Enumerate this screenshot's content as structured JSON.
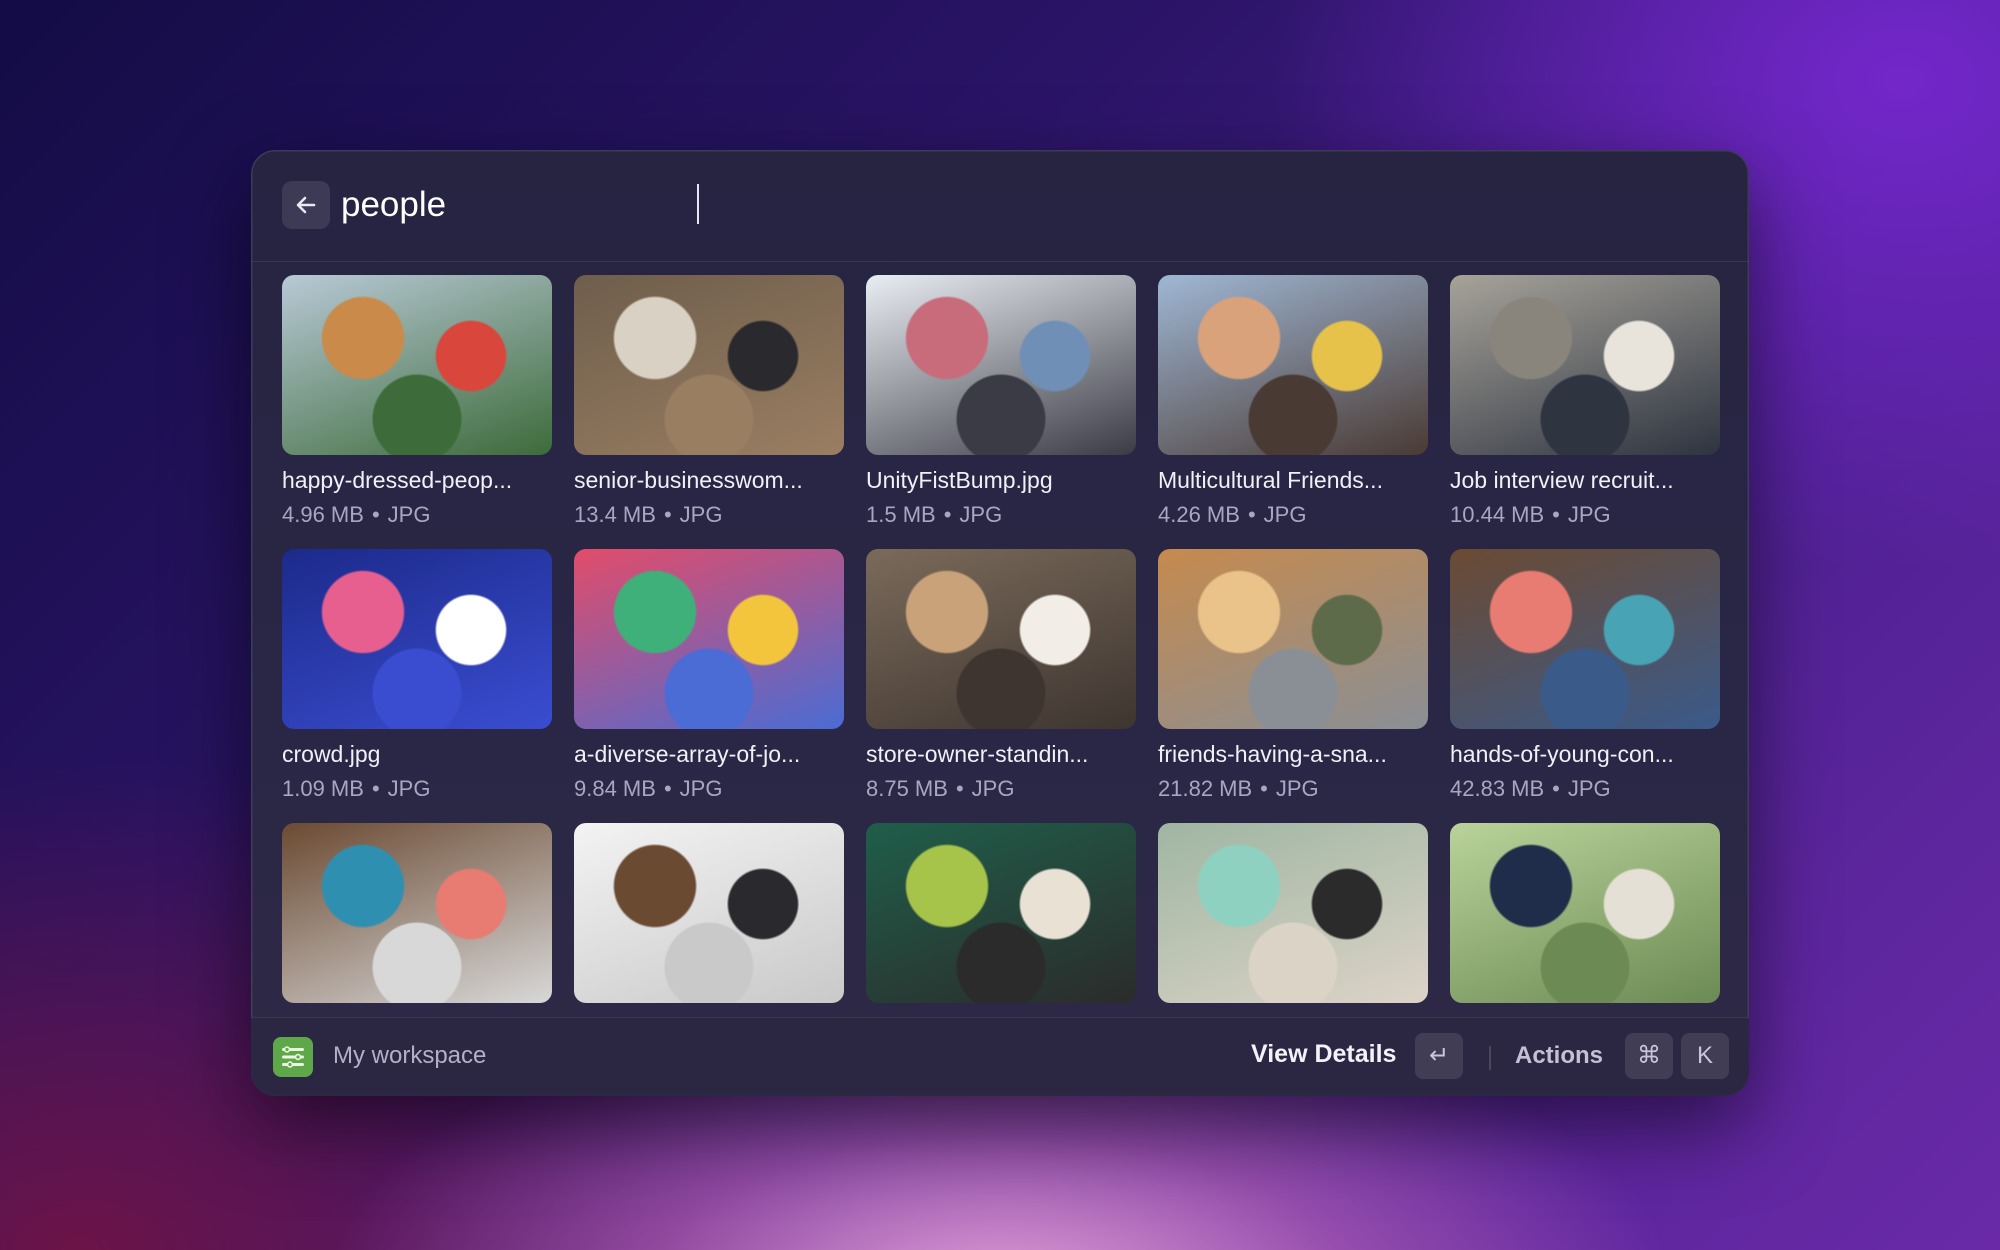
{
  "search": {
    "query": "people",
    "back_icon": "arrow-left-icon"
  },
  "results": [
    {
      "name": "happy-dressed-peop...",
      "size": "4.96 MB",
      "type": "JPG",
      "thumb_colors": [
        "#b8c9d6",
        "#c98a4a",
        "#d9463c",
        "#3d6b3a"
      ]
    },
    {
      "name": "senior-businesswom...",
      "size": "13.4 MB",
      "type": "JPG",
      "thumb_colors": [
        "#6e5e4c",
        "#d9d2c4",
        "#2a2a2e",
        "#9a7e62"
      ]
    },
    {
      "name": "UnityFistBump.jpg",
      "size": "1.5 MB",
      "type": "JPG",
      "thumb_colors": [
        "#e9eef3",
        "#c86b7a",
        "#6f8fb6",
        "#3b3b45"
      ]
    },
    {
      "name": "Multicultural Friends...",
      "size": "4.26 MB",
      "type": "JPG",
      "thumb_colors": [
        "#9fb7d4",
        "#d9a27a",
        "#e6c24a",
        "#4a3a34"
      ]
    },
    {
      "name": "Job interview recruit...",
      "size": "10.44 MB",
      "type": "JPG",
      "thumb_colors": [
        "#a7a39a",
        "#8a857c",
        "#e8e4dc",
        "#2e3440"
      ]
    },
    {
      "name": "crowd.jpg",
      "size": "1.09 MB",
      "type": "JPG",
      "thumb_colors": [
        "#1c2a8a",
        "#e65f8e",
        "#ffffff",
        "#3a4dd1"
      ]
    },
    {
      "name": "a-diverse-array-of-jo...",
      "size": "9.84 MB",
      "type": "JPG",
      "thumb_colors": [
        "#e24c6a",
        "#3fb07a",
        "#f2c53d",
        "#4a6cd4"
      ]
    },
    {
      "name": "store-owner-standin...",
      "size": "8.75 MB",
      "type": "JPG",
      "thumb_colors": [
        "#7a6a5a",
        "#c9a27a",
        "#f2ede6",
        "#3e3530"
      ]
    },
    {
      "name": "friends-having-a-sna...",
      "size": "21.82 MB",
      "type": "JPG",
      "thumb_colors": [
        "#c68a4e",
        "#e9c389",
        "#5d6b4a",
        "#8a8f95"
      ]
    },
    {
      "name": "hands-of-young-con...",
      "size": "42.83 MB",
      "type": "JPG",
      "thumb_colors": [
        "#6b4a32",
        "#e87b72",
        "#48a3b4",
        "#3a5a8a"
      ]
    },
    {
      "name": "",
      "size": "",
      "type": "",
      "thumb_colors": [
        "#6b4a32",
        "#2f8fb0",
        "#e87b72",
        "#d8d8d8"
      ]
    },
    {
      "name": "",
      "size": "",
      "type": "",
      "thumb_colors": [
        "#f3f3f3",
        "#6b4a32",
        "#2a2a2e",
        "#c9c9c9"
      ]
    },
    {
      "name": "",
      "size": "",
      "type": "",
      "thumb_colors": [
        "#1f5e4a",
        "#a6c34a",
        "#e9e2d4",
        "#2b2b2b"
      ]
    },
    {
      "name": "",
      "size": "",
      "type": "",
      "thumb_colors": [
        "#9fb6a2",
        "#8fd1c0",
        "#2b2b2b",
        "#dcd3c7"
      ]
    },
    {
      "name": "",
      "size": "",
      "type": "",
      "thumb_colors": [
        "#b9d39a",
        "#1f2c4a",
        "#e4e0d6",
        "#6c8a54"
      ]
    }
  ],
  "meta_separator": "•",
  "footer": {
    "workspace_icon": "workspace-icon",
    "workspace_label": "My workspace",
    "primary_action": "View Details",
    "enter_key": "↵",
    "actions_label": "Actions",
    "cmd_key": "⌘",
    "k_key": "K"
  }
}
